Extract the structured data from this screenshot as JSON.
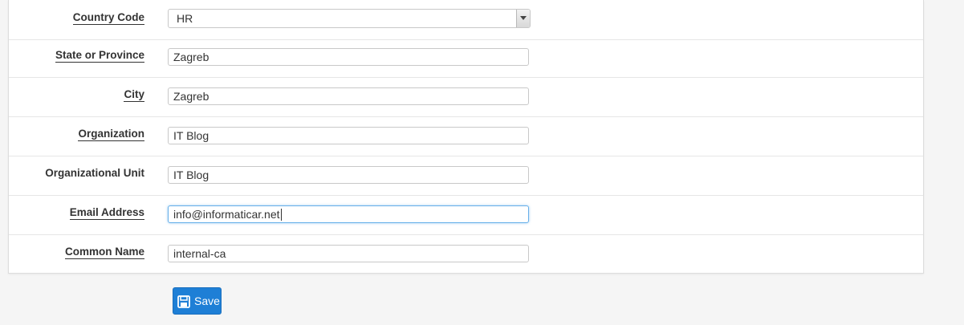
{
  "form": {
    "fields": [
      {
        "label": "Country Code",
        "value": "HR",
        "type": "select"
      },
      {
        "label": "State or Province",
        "value": "Zagreb",
        "type": "text"
      },
      {
        "label": "City",
        "value": "Zagreb",
        "type": "text"
      },
      {
        "label": "Organization",
        "value": "IT Blog",
        "type": "text"
      },
      {
        "label": "Organizational Unit",
        "value": "IT Blog",
        "type": "text"
      },
      {
        "label": "Email Address",
        "value": "info@informaticar.net",
        "type": "text",
        "focused": true
      },
      {
        "label": "Common Name",
        "value": "internal-ca",
        "type": "text"
      }
    ]
  },
  "actions": {
    "save_label": "Save",
    "save_icon": "floppy-disk-icon",
    "accent_color": "#1e7fd6"
  }
}
